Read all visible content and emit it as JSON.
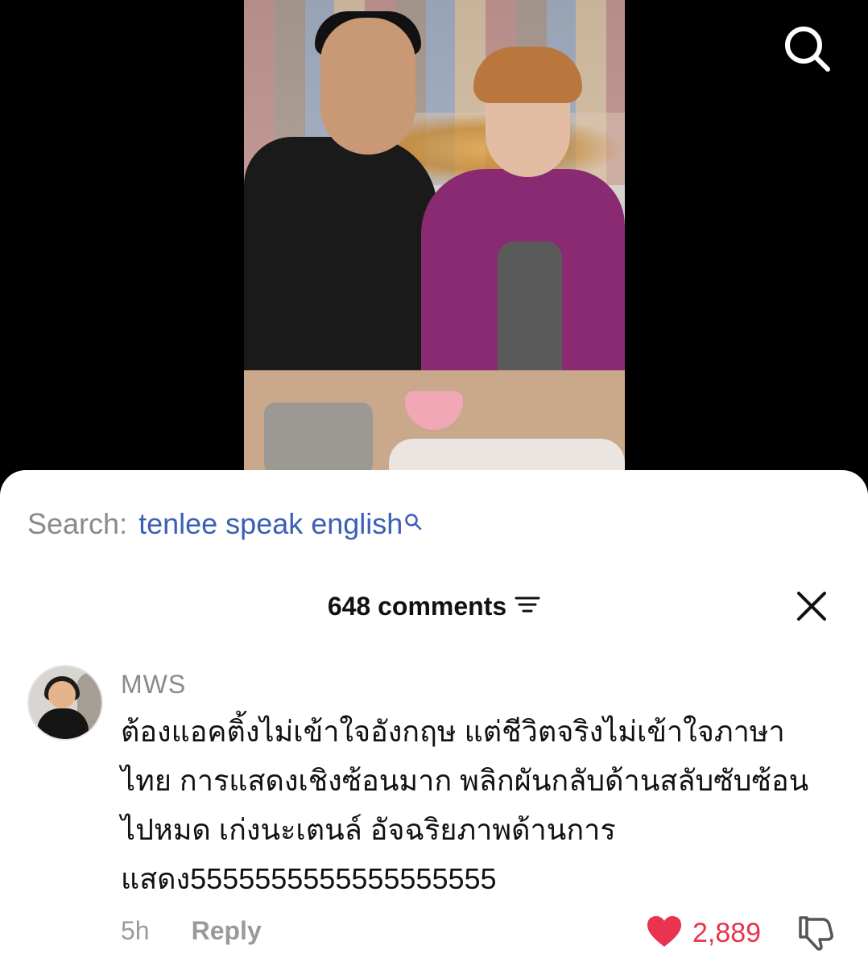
{
  "search_suggestion": {
    "label": "Search:",
    "query": "tenlee speak english"
  },
  "comments_panel": {
    "count_label": "648 comments"
  },
  "comment": {
    "username": "MWS",
    "text": "ต้องแอคติ้งไม่เข้าใจอังกฤษ แต่ชีวิตจริงไม่เข้าใจภาษาไทย การแสดงเชิงซ้อนมาก พลิกผันกลับด้านสลับซับซ้อนไปหมด เก่งนะเตนล์ อัจฉริยภาพด้านการแสดง5555555555555555555",
    "time": "5h",
    "reply_label": "Reply",
    "likes": "2,889"
  },
  "colors": {
    "accent_link": "#3c5fb6",
    "like_red": "#e8344f",
    "muted_gray": "#8a8a8a"
  },
  "icons": [
    "search-icon",
    "sort-icon",
    "close-icon",
    "heart-icon",
    "dislike-icon",
    "search-mini-icon"
  ]
}
